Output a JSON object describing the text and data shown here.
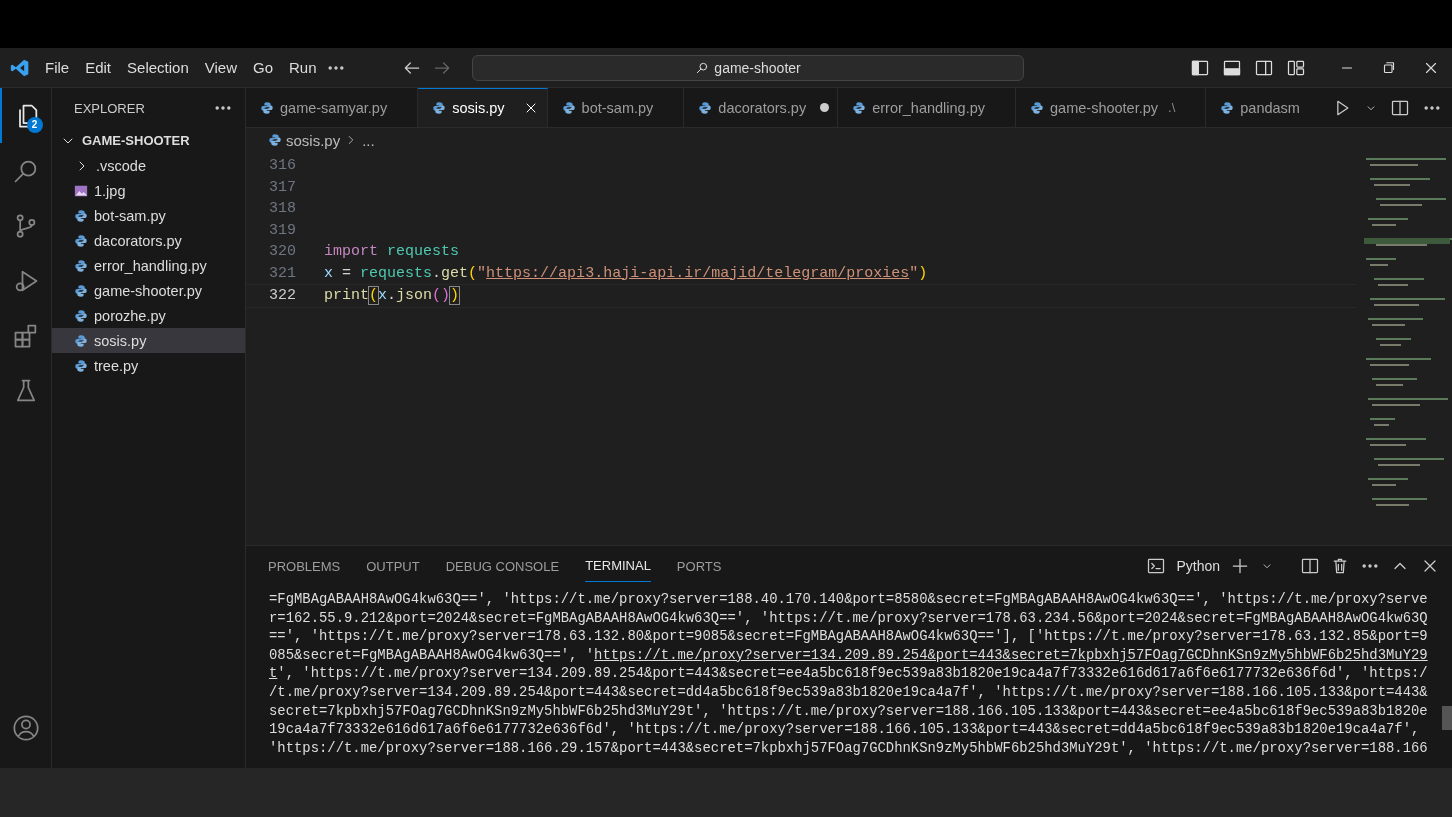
{
  "menu": [
    "File",
    "Edit",
    "Selection",
    "View",
    "Go",
    "Run"
  ],
  "command_center": {
    "text": "game-shooter"
  },
  "activity_bar": [
    {
      "kind": "explorer",
      "selected": true,
      "badge": "2"
    },
    {
      "kind": "search",
      "selected": false
    },
    {
      "kind": "source-control",
      "selected": false
    },
    {
      "kind": "run",
      "selected": false
    },
    {
      "kind": "extensions",
      "selected": false
    },
    {
      "kind": "testing",
      "selected": false
    }
  ],
  "sidebar": {
    "title": "EXPLORER",
    "folder": {
      "name": "GAME-SHOOTER",
      "expanded": true,
      "children": [
        {
          "name": ".vscode",
          "kind": "folder",
          "expanded": false,
          "selected": false
        },
        {
          "name": "1.jpg",
          "kind": "image",
          "selected": false
        },
        {
          "name": "bot-sam.py",
          "kind": "python",
          "selected": false
        },
        {
          "name": "dacorators.py",
          "kind": "python",
          "selected": false
        },
        {
          "name": "error_handling.py",
          "kind": "python",
          "selected": false
        },
        {
          "name": "game-shooter.py",
          "kind": "python",
          "selected": false
        },
        {
          "name": "porozhe.py",
          "kind": "python",
          "selected": false
        },
        {
          "name": "sosis.py",
          "kind": "python",
          "selected": true
        },
        {
          "name": "tree.py",
          "kind": "python",
          "selected": false
        }
      ]
    }
  },
  "tabs": [
    {
      "label": "game-samyar.py",
      "selected": false,
      "modified": false
    },
    {
      "label": "sosis.py",
      "selected": true,
      "modified": false
    },
    {
      "label": "bot-sam.py",
      "selected": false,
      "modified": false
    },
    {
      "label": "dacorators.py",
      "selected": false,
      "modified": true
    },
    {
      "label": "error_handling.py",
      "selected": false,
      "modified": false
    },
    {
      "label": "game-shooter.py",
      "selected": false,
      "modified": false,
      "description": ".\\"
    },
    {
      "label": "pandasm",
      "selected": false,
      "modified": false
    }
  ],
  "breadcrumb": {
    "file": "sosis.py",
    "rest": "..."
  },
  "editor": {
    "lines": [
      {
        "number": "316",
        "current": false
      },
      {
        "number": "317",
        "current": false
      },
      {
        "number": "318",
        "current": false
      },
      {
        "number": "319",
        "current": false
      },
      {
        "number": "320",
        "current": false,
        "tokens": [
          {
            "kind": "keyword",
            "text": "import "
          },
          {
            "kind": "module",
            "text": "requests"
          }
        ]
      },
      {
        "number": "321",
        "current": false,
        "tokens": [
          {
            "kind": "variable",
            "text": "x"
          },
          {
            "kind": "plain",
            "text": " = "
          },
          {
            "kind": "module",
            "text": "requests"
          },
          {
            "kind": "plain",
            "text": "."
          },
          {
            "kind": "function",
            "text": "get"
          },
          {
            "kind": "bracket",
            "text": "("
          },
          {
            "kind": "string",
            "text": "\""
          },
          {
            "kind": "url",
            "text": "https://api3.haji-api.ir/majid/telegram/proxies"
          },
          {
            "kind": "string",
            "text": "\""
          },
          {
            "kind": "bracket",
            "text": ")"
          }
        ]
      },
      {
        "number": "322",
        "current": true,
        "tokens": [
          {
            "kind": "function",
            "text": "print"
          },
          {
            "kind": "bracket-match",
            "text": "("
          },
          {
            "kind": "variable",
            "text": "x"
          },
          {
            "kind": "plain",
            "text": "."
          },
          {
            "kind": "function",
            "text": "json"
          },
          {
            "kind": "bracket-inner",
            "text": "()"
          },
          {
            "kind": "bracket-match",
            "text": ")"
          }
        ]
      }
    ]
  },
  "panel": {
    "tabs": [
      {
        "label": "PROBLEMS",
        "selected": false
      },
      {
        "label": "OUTPUT",
        "selected": false
      },
      {
        "label": "DEBUG CONSOLE",
        "selected": false
      },
      {
        "label": "TERMINAL",
        "selected": true
      },
      {
        "label": "PORTS",
        "selected": false
      }
    ],
    "terminal_name": "Python",
    "terminal_lines": [
      [
        {
          "text": "=FgMBAgABAAH8AwOG4kw63Q==', 'https://t.me/proxy?server=188.40.170.140&port=8580&secret=FgMBAgABAAH8AwOG4kw63Q==', 'https://t.me/proxy?serve",
          "link": false
        }
      ],
      [
        {
          "text": "r=162.55.9.212&port=2024&secret=FgMBAgABAAH8AwOG4kw63Q==', 'https://t.me/proxy?server=178.63.234.56&port=2024&secret=FgMBAgABAAH8AwOG4kw63Q",
          "link": false
        }
      ],
      [
        {
          "text": "==', 'https://t.me/proxy?server=178.63.132.80&port=9085&secret=FgMBAgABAAH8AwOG4kw63Q=='], ['https://t.me/proxy?server=178.63.132.85&port=9",
          "link": false
        }
      ],
      [
        {
          "text": "085&secret=FgMBAgABAAH8AwOG4kw63Q==', '",
          "link": false
        },
        {
          "text": "https://t.me/proxy?server=134.209.89.254&port=443&secret=7kpbxhj57FOag7GCDhnKSn9zMy5hbWF6b25hd3MuY29",
          "link": true
        }
      ],
      [
        {
          "text": "t",
          "link": true
        },
        {
          "text": "', 'https://t.me/proxy?server=134.209.89.254&port=443&secret=ee4a5bc618f9ec539a83b1820e19ca4a7f73332e616d617a6f6e6177732e636f6d', 'https:/",
          "link": false
        }
      ],
      [
        {
          "text": "/t.me/proxy?server=134.209.89.254&port=443&secret=dd4a5bc618f9ec539a83b1820e19ca4a7f', 'https://t.me/proxy?server=188.166.105.133&port=443&",
          "link": false
        }
      ],
      [
        {
          "text": "secret=7kpbxhj57FOag7GCDhnKSn9zMy5hbWF6b25hd3MuY29t', 'https://t.me/proxy?server=188.166.105.133&port=443&secret=ee4a5bc618f9ec539a83b1820e",
          "link": false
        }
      ],
      [
        {
          "text": "19ca4a7f73332e616d617a6f6e6177732e636f6d', 'https://t.me/proxy?server=188.166.105.133&port=443&secret=dd4a5bc618f9ec539a83b1820e19ca4a7f',",
          "link": false
        }
      ],
      [
        {
          "text": "'https://t.me/proxy?server=188.166.29.157&port=443&secret=7kpbxhj57FOag7GCDhnKSn9zMy5hbWF6b25hd3MuY29t', 'https://t.me/proxy?server=188.166",
          "link": false
        }
      ]
    ]
  }
}
